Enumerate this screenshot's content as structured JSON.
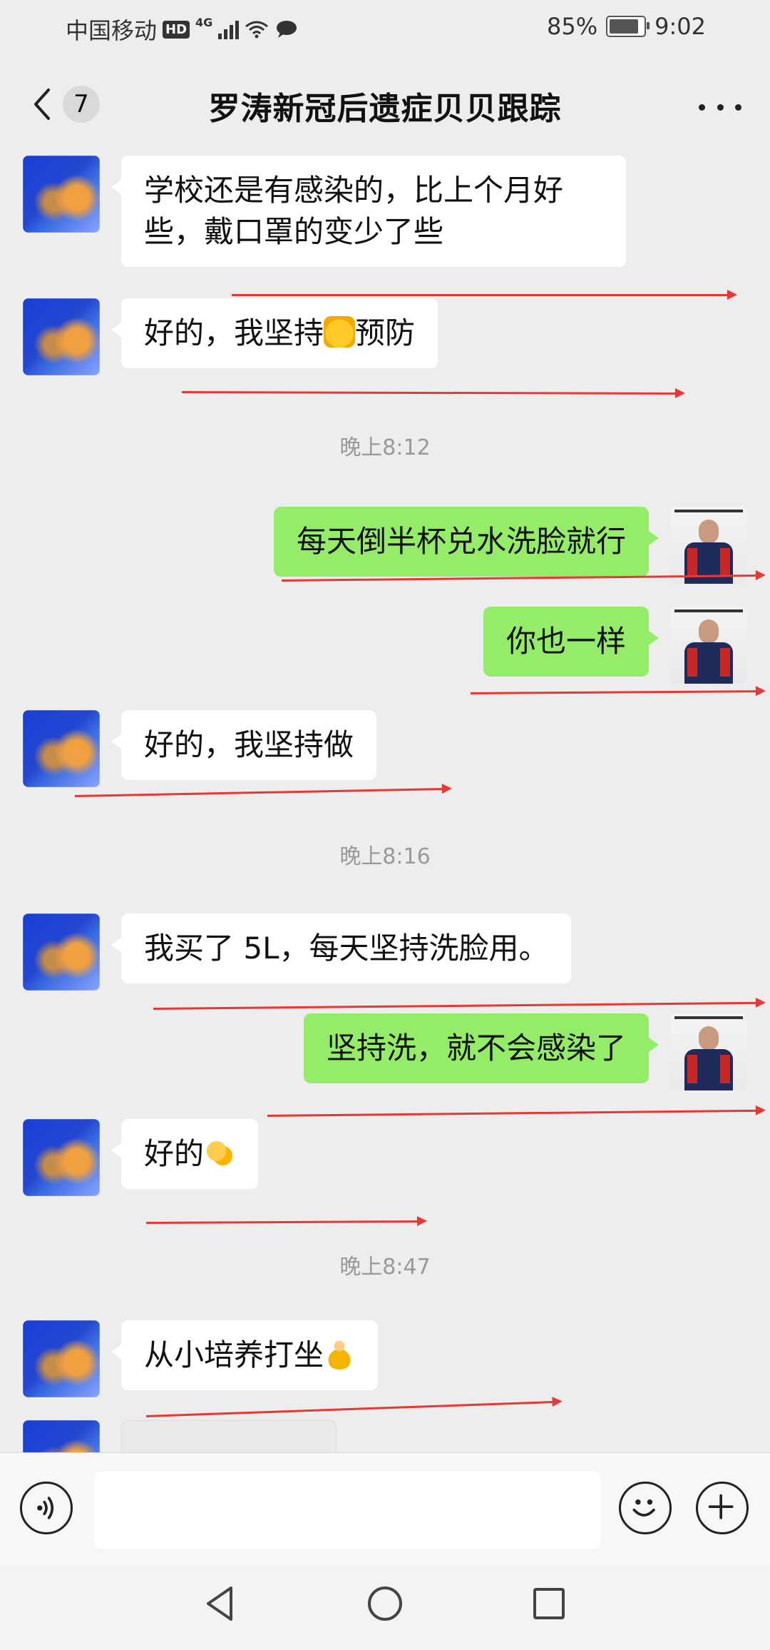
{
  "status_bar": {
    "carrier": "中国移动",
    "hd": "HD",
    "network": "4G",
    "battery_percent": "85%",
    "time": "9:02",
    "icons": [
      "hd-icon",
      "signal-icon",
      "wifi-icon",
      "message-icon",
      "battery-icon"
    ]
  },
  "header": {
    "back_icon": "chevron-left-icon",
    "unread_count": "7",
    "title": "罗涛新冠后遗症贝贝跟踪",
    "more_icon": "more-icon"
  },
  "messages": [
    {
      "side": "left",
      "text": "学校还是有感染的，比上个月好些，戴口罩的变少了些"
    },
    {
      "side": "left",
      "text_before": "好的，我坚持",
      "emoji": "fist-emoji",
      "text_after": "预防"
    },
    {
      "type": "time",
      "text": "晚上8:12"
    },
    {
      "side": "right",
      "text": "每天倒半杯兑水洗脸就行"
    },
    {
      "side": "right",
      "text": "你也一样"
    },
    {
      "side": "left",
      "text": "好的，我坚持做"
    },
    {
      "type": "time",
      "text": "晚上8:16"
    },
    {
      "side": "left",
      "text": "我买了 5L，每天坚持洗脸用。"
    },
    {
      "side": "right",
      "text": "坚持洗，就不会感染了"
    },
    {
      "side": "left",
      "text_before": "好的",
      "emoji": "ok-hand-emoji",
      "text_after": ""
    },
    {
      "type": "time",
      "text": "晚上8:47"
    },
    {
      "side": "left",
      "text_before": "从小培养打坐",
      "emoji": "person-in-lotus-position-emoji",
      "text_after": ""
    },
    {
      "side": "left",
      "type": "image"
    }
  ],
  "input_bar": {
    "voice_icon": "voice-icon",
    "input_value": "",
    "emoji_icon": "smiley-icon",
    "plus_icon": "plus-icon"
  },
  "nav_bar": {
    "back_icon": "nav-back-icon",
    "home_icon": "nav-home-icon",
    "recent_icon": "nav-recent-icon"
  },
  "colors": {
    "background": "#ededed",
    "bubble_left": "#ffffff",
    "bubble_right": "#95ec69",
    "annotation": "#e53935"
  }
}
